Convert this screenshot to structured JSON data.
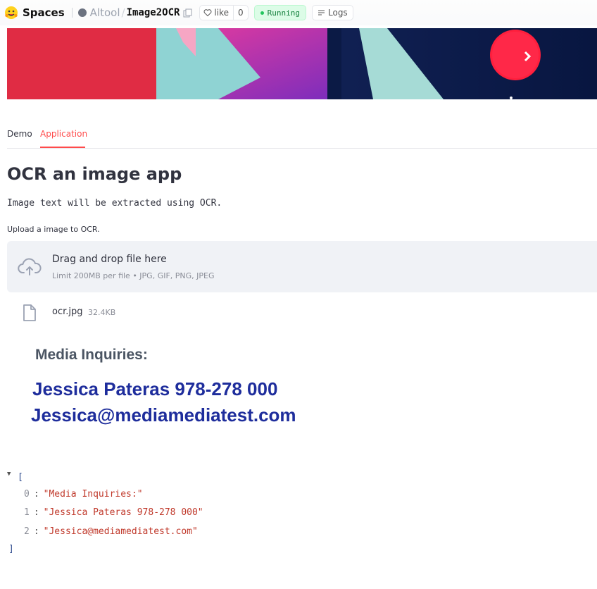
{
  "topbar": {
    "spaces_label": "Spaces",
    "owner": "Altool",
    "separator": "/",
    "repo": "Image2OCR",
    "like_label": "like",
    "like_count": "0",
    "status": "Running",
    "logs_label": "Logs"
  },
  "tabs": [
    {
      "label": "Demo",
      "active": false
    },
    {
      "label": "Application",
      "active": true
    }
  ],
  "main": {
    "title": "OCR an image app",
    "description": "Image text will be extracted using OCR.",
    "upload_label": "Upload a image to OCR.",
    "dropzone": {
      "title": "Drag and drop file here",
      "subtitle": "Limit 200MB per file • JPG, GIF, PNG, JPEG"
    },
    "file": {
      "name": "ocr.jpg",
      "size": "32.4KB"
    },
    "ocr_image": {
      "lines": [
        "Media Inquiries:",
        "Jessica Pateras 978-278 000",
        "Jessica@mediamediatest.com"
      ]
    },
    "json_output": {
      "open": "[",
      "close": "]",
      "items": [
        {
          "index": "0",
          "value": "\"Media Inquiries:\""
        },
        {
          "index": "1",
          "value": "\"Jessica Pateras 978-278 000\""
        },
        {
          "index": "2",
          "value": "\"Jessica@mediamediatest.com\""
        }
      ]
    }
  },
  "colors": {
    "accent": "#ff4b4b",
    "running_bg": "#dcfce7",
    "ocr_blue": "#1e2d9c",
    "dropzone_bg": "#f0f2f6"
  },
  "icons": [
    "hugging-face-logo-icon",
    "copy-icon",
    "heart-icon",
    "logs-icon",
    "cloud-upload-icon",
    "file-icon",
    "caret-down-icon"
  ]
}
